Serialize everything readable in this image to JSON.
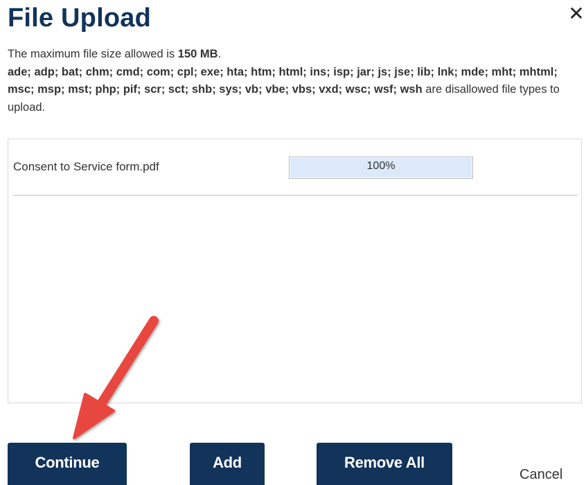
{
  "dialog": {
    "title": "File Upload",
    "close_symbol": "✕"
  },
  "info": {
    "max_size_prefix": "The maximum file size allowed is",
    "max_size_value": "150 MB",
    "max_size_suffix": ".",
    "disallowed_types": "ade; adp; bat; chm; cmd; com; cpl; exe; hta; htm; html; ins; isp; jar; js; jse; lib; lnk; mde; mht; mhtml; msc; msp; mst; php; pif; scr; sct; shb; sys; vb; vbe; vbs; vxd; wsc; wsf; wsh",
    "disallowed_suffix": " are disallowed file types to upload."
  },
  "files": [
    {
      "name": "Consent to Service form.pdf",
      "progress_label": "100%",
      "progress_fraction": 1.0
    }
  ],
  "buttons": {
    "continue": "Continue",
    "add": "Add",
    "remove_all": "Remove All",
    "cancel": "Cancel"
  },
  "colors": {
    "primary": "#12335a",
    "progress_fill": "#dbe9f8",
    "annotation_arrow": "#e8463f"
  }
}
